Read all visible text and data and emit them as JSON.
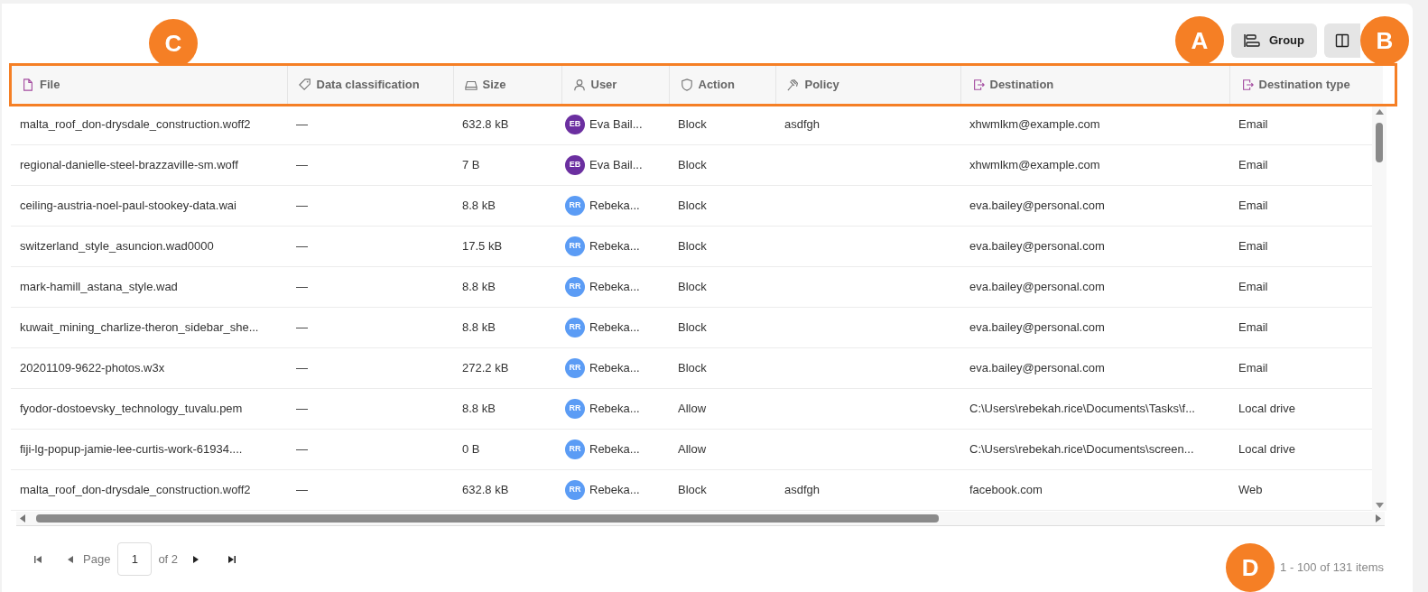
{
  "toolbar": {
    "group_button": "Group"
  },
  "callouts": [
    {
      "kind": "C",
      "label": "C"
    },
    {
      "kind": "A",
      "label": "A"
    },
    {
      "kind": "B",
      "label": "B"
    },
    {
      "kind": "D",
      "label": "D"
    }
  ],
  "table": {
    "columns": [
      {
        "label": "File",
        "kind": "file"
      },
      {
        "label": "Data classification",
        "kind": "tag"
      },
      {
        "label": "Size",
        "kind": "drive"
      },
      {
        "label": "User",
        "kind": "user"
      },
      {
        "label": "Action",
        "kind": "shield"
      },
      {
        "label": "Policy",
        "kind": "gavel"
      },
      {
        "label": "Destination",
        "kind": "exit"
      },
      {
        "label": "Destination type",
        "kind": "exit"
      }
    ],
    "rows": [
      {
        "file": "malta_roof_don-drysdale_construction.woff2",
        "classification": "—",
        "size": "632.8 kB",
        "user_initials": "EB",
        "user": "Eva Bail...",
        "color": "#6b2fa0",
        "action": "Block",
        "policy": "asdfgh",
        "destination": "xhwmlkm@example.com",
        "destination_type": "Email"
      },
      {
        "file": "regional-danielle-steel-brazzaville-sm.woff",
        "classification": "—",
        "size": "7 B",
        "user_initials": "EB",
        "user": "Eva Bail...",
        "color": "#6b2fa0",
        "action": "Block",
        "policy": "",
        "destination": "xhwmlkm@example.com",
        "destination_type": "Email"
      },
      {
        "file": "ceiling-austria-noel-paul-stookey-data.wai",
        "classification": "—",
        "size": "8.8 kB",
        "user_initials": "RR",
        "user": "Rebeka...",
        "color": "#5b9cf5",
        "action": "Block",
        "policy": "",
        "destination": "eva.bailey@personal.com",
        "destination_type": "Email"
      },
      {
        "file": "switzerland_style_asuncion.wad0000",
        "classification": "—",
        "size": "17.5 kB",
        "user_initials": "RR",
        "user": "Rebeka...",
        "color": "#5b9cf5",
        "action": "Block",
        "policy": "",
        "destination": "eva.bailey@personal.com",
        "destination_type": "Email"
      },
      {
        "file": "mark-hamill_astana_style.wad",
        "classification": "—",
        "size": "8.8 kB",
        "user_initials": "RR",
        "user": "Rebeka...",
        "color": "#5b9cf5",
        "action": "Block",
        "policy": "",
        "destination": "eva.bailey@personal.com",
        "destination_type": "Email"
      },
      {
        "file": "kuwait_mining_charlize-theron_sidebar_she...",
        "classification": "—",
        "size": "8.8 kB",
        "user_initials": "RR",
        "user": "Rebeka...",
        "color": "#5b9cf5",
        "action": "Block",
        "policy": "",
        "destination": "eva.bailey@personal.com",
        "destination_type": "Email"
      },
      {
        "file": "20201109-9622-photos.w3x",
        "classification": "—",
        "size": "272.2 kB",
        "user_initials": "RR",
        "user": "Rebeka...",
        "color": "#5b9cf5",
        "action": "Block",
        "policy": "",
        "destination": "eva.bailey@personal.com",
        "destination_type": "Email"
      },
      {
        "file": "fyodor-dostoevsky_technology_tuvalu.pem",
        "classification": "—",
        "size": "8.8 kB",
        "user_initials": "RR",
        "user": "Rebeka...",
        "color": "#5b9cf5",
        "action": "Allow",
        "policy": "",
        "destination": "C:\\Users\\rebekah.rice\\Documents\\Tasks\\f...",
        "destination_type": "Local drive"
      },
      {
        "file": "fiji-lg-popup-jamie-lee-curtis-work-61934....",
        "classification": "—",
        "size": "0 B",
        "user_initials": "RR",
        "user": "Rebeka...",
        "color": "#5b9cf5",
        "action": "Allow",
        "policy": "",
        "destination": "C:\\Users\\rebekah.rice\\Documents\\screen...",
        "destination_type": "Local drive"
      },
      {
        "file": "malta_roof_don-drysdale_construction.woff2",
        "classification": "—",
        "size": "632.8 kB",
        "user_initials": "RR",
        "user": "Rebeka...",
        "color": "#5b9cf5",
        "action": "Block",
        "policy": "asdfgh",
        "destination": "facebook.com",
        "destination_type": "Web"
      }
    ]
  },
  "pager": {
    "page_label": "Page",
    "page": "1",
    "of": "of 2",
    "summary": "1 - 100 of 131 items"
  }
}
